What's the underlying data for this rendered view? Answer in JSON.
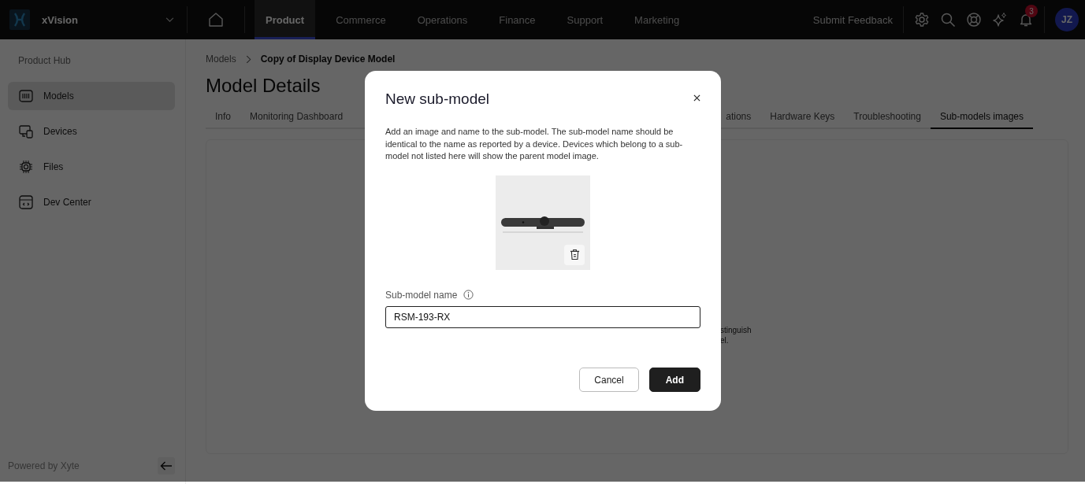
{
  "topbar": {
    "app_name": "xVision",
    "nav": [
      {
        "label": "Product",
        "selected": true
      },
      {
        "label": "Commerce",
        "selected": false
      },
      {
        "label": "Operations",
        "selected": false
      },
      {
        "label": "Finance",
        "selected": false
      },
      {
        "label": "Support",
        "selected": false
      },
      {
        "label": "Marketing",
        "selected": false
      }
    ],
    "feedback": "Submit Feedback",
    "notification_count": "3",
    "avatar": "JZ"
  },
  "sidebar": {
    "title": "Product Hub",
    "items": [
      {
        "label": "Models",
        "selected": true
      },
      {
        "label": "Devices",
        "selected": false
      },
      {
        "label": "Files",
        "selected": false
      },
      {
        "label": "Dev Center",
        "selected": false
      }
    ],
    "footer": "Powered by Xyte"
  },
  "breadcrumb": [
    "Models",
    "Copy of Display Device Model"
  ],
  "page_title": "Model Details",
  "tabs": [
    {
      "label": "Info",
      "selected": false
    },
    {
      "label": "Monitoring Dashboard",
      "selected": false
    },
    {
      "label": "ations",
      "selected": false
    },
    {
      "label": "Hardware Keys",
      "selected": false
    },
    {
      "label": "Troubleshooting",
      "selected": false
    },
    {
      "label": "Sub-models images",
      "selected": true
    }
  ],
  "content_fragment": [
    "stinguish",
    "el."
  ],
  "dialog": {
    "title": "New sub-model",
    "description": "Add an image and name to the sub-model. The sub-model name should be identical to the name as reported by a device. Devices which belong to a sub-model not listed here will show the parent model image.",
    "field_label": "Sub-model name",
    "field_value": "RSM-193-RX",
    "buttons": [
      {
        "label": "Cancel",
        "kind": "secondary"
      },
      {
        "label": "Add",
        "kind": "primary"
      }
    ]
  }
}
